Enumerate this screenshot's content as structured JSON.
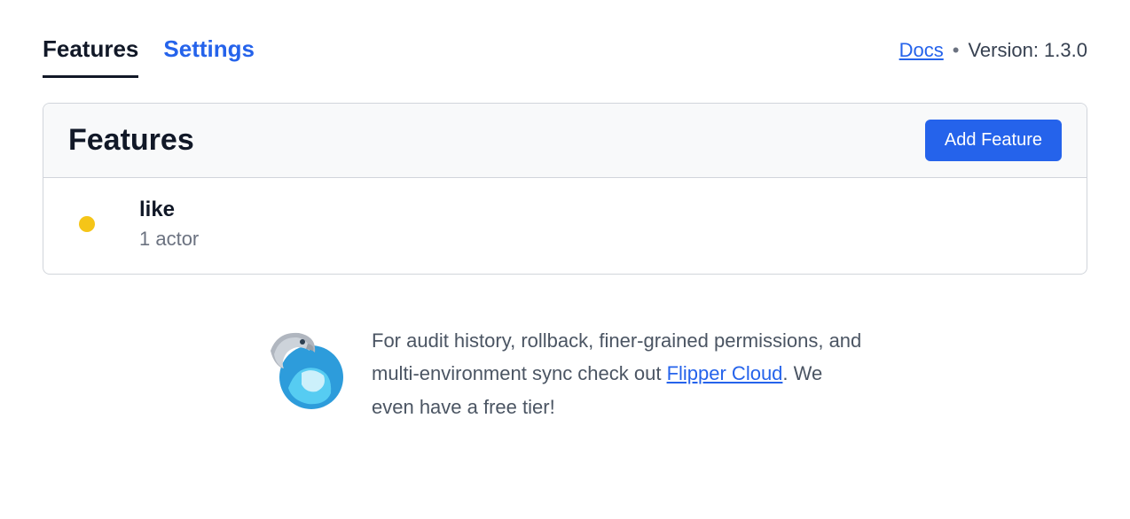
{
  "nav": {
    "tabs": [
      {
        "label": "Features",
        "active": true
      },
      {
        "label": "Settings",
        "active": false
      }
    ],
    "docs_label": "Docs",
    "separator": "•",
    "version_label": "Version: 1.3.0"
  },
  "panel": {
    "title": "Features",
    "add_button_label": "Add Feature"
  },
  "features": [
    {
      "name": "like",
      "detail": "1 actor",
      "status_color": "#f5c518"
    }
  ],
  "promo": {
    "text_before": "For audit history, rollback, finer-grained permissions, and multi-environment sync check out ",
    "link_label": "Flipper Cloud",
    "text_after": ". We even have a free tier!"
  }
}
